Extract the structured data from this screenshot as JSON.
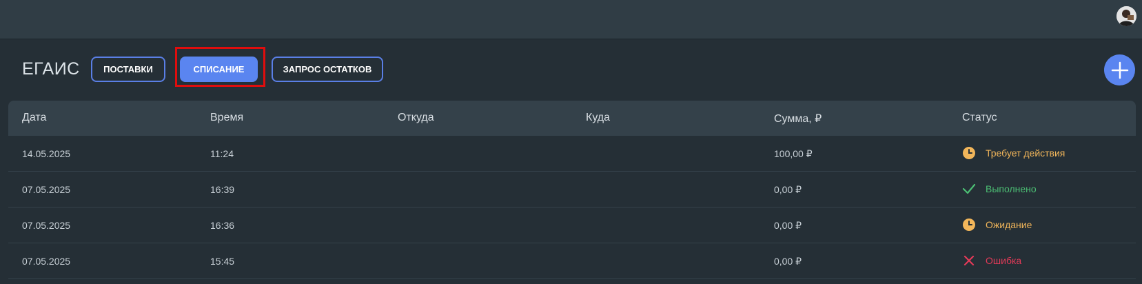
{
  "header": {
    "avatar_icon": "user-avatar"
  },
  "page": {
    "title": "ЕГАИС"
  },
  "tabs": [
    {
      "label": "ПОСТАВКИ",
      "active": false
    },
    {
      "label": "СПИСАНИЕ",
      "active": true
    },
    {
      "label": "ЗАПРОС ОСТАТКОВ",
      "active": false
    }
  ],
  "add_button_icon": "plus-icon",
  "table": {
    "columns": [
      "Дата",
      "Время",
      "Откуда",
      "Куда",
      "Сумма, ₽",
      "Статус"
    ],
    "rows": [
      {
        "date": "14.05.2025",
        "time": "11:24",
        "from": "",
        "to": "",
        "sum": "100,00 ₽",
        "status": "Требует действия",
        "status_icon": "clock-icon",
        "status_color": "#f2b65a"
      },
      {
        "date": "07.05.2025",
        "time": "16:39",
        "from": "",
        "to": "",
        "sum": "0,00 ₽",
        "status": "Выполнено",
        "status_icon": "check-icon",
        "status_color": "#4cbf74"
      },
      {
        "date": "07.05.2025",
        "time": "16:36",
        "from": "",
        "to": "",
        "sum": "0,00 ₽",
        "status": "Ожидание",
        "status_icon": "clock-icon",
        "status_color": "#f2b65a"
      },
      {
        "date": "07.05.2025",
        "time": "15:45",
        "from": "",
        "to": "",
        "sum": "0,00 ₽",
        "status": "Ошибка",
        "status_icon": "cross-icon",
        "status_color": "#e23a58"
      }
    ]
  },
  "colors": {
    "accent": "#5a85f0",
    "highlight": "#e00d0d",
    "background": "#252f36",
    "topbar": "#303d45"
  }
}
